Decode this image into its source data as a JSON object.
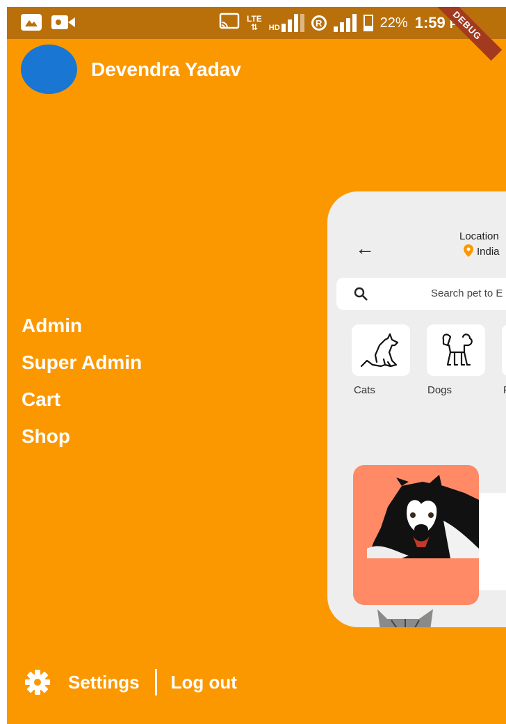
{
  "status_bar": {
    "battery": "22%",
    "time": "1:59",
    "ampm": "PM",
    "network": "LTE",
    "network_hd": "HD",
    "roaming": "R",
    "debug": "DEBUG"
  },
  "drawer": {
    "user_name": "Devendra Yadav",
    "menu": [
      "Admin",
      "Super Admin",
      "Cart",
      "Shop"
    ],
    "settings_label": "Settings",
    "logout_label": "Log out"
  },
  "preview": {
    "location_label": "Location",
    "location_value": "India",
    "search_placeholder": "Search pet to E",
    "categories": [
      "Cats",
      "Dogs",
      "Pa"
    ]
  },
  "colors": {
    "drawer_bg": "#FB9800",
    "status_bar": "#B96F0A",
    "avatar": "#1976D2",
    "pet_card": "#FF8A65",
    "accent_pin": "#FB9800"
  }
}
